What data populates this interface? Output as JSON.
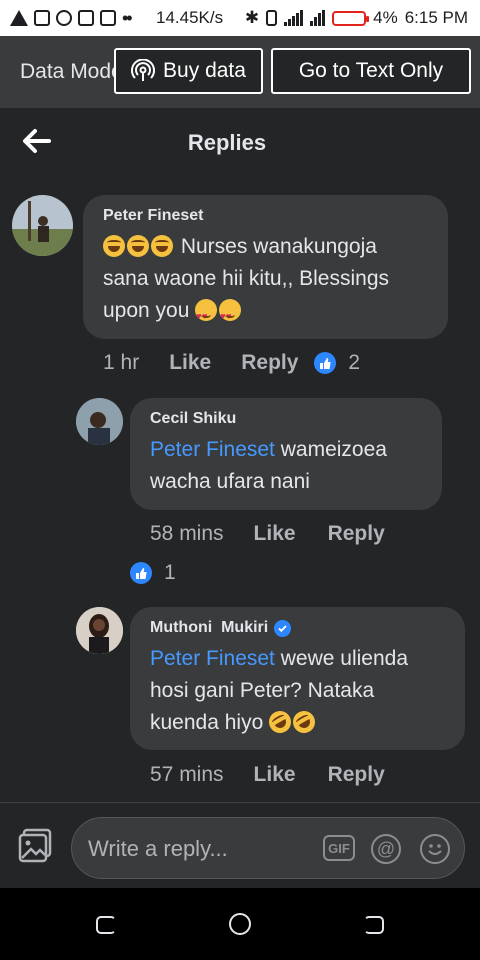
{
  "status_bar": {
    "speed": "14.45K/s",
    "battery_percent": "4%",
    "time": "6:15 PM",
    "icons": [
      "warning-icon",
      "news-icon",
      "facebook-icon",
      "instagram-icon",
      "messenger-icon",
      "bluetooth-icon",
      "vibrate-icon",
      "signal-icon",
      "battery-icon"
    ]
  },
  "data_bar": {
    "mode_label": "Data Mode",
    "buy_data_label": "Buy data",
    "text_only_label": "Go to Text Only"
  },
  "header": {
    "title": "Replies"
  },
  "comments": [
    {
      "author": "Peter Fineset",
      "text_main": " Nurses wanakungoja sana waone hii kitu,, Blessings upon you ",
      "emojis_before": [
        "face-with-tears-of-joy",
        "face-with-tears-of-joy",
        "face-with-tears-of-joy"
      ],
      "emojis_after": [
        "smiling-face-with-hearts",
        "smiling-face-with-hearts"
      ],
      "time": "1 hr",
      "like_label": "Like",
      "reply_label": "Reply",
      "reaction_count": "2"
    },
    {
      "author": "Cecil Shiku",
      "mention": "Peter Fineset",
      "text_main": " wameizoea wacha ufara nani",
      "time": "58 mins",
      "like_label": "Like",
      "reply_label": "Reply",
      "reaction_count": "1"
    },
    {
      "author": "Muthoni  Mukiri",
      "verified": true,
      "mention": "Peter Fineset",
      "text_main": " wewe ulienda hosi gani Peter? Nataka kuenda hiyo ",
      "emojis_after": [
        "rolling-on-floor-laughing",
        "rolling-on-floor-laughing"
      ],
      "time": "57 mins",
      "like_label": "Like",
      "reply_label": "Reply"
    }
  ],
  "composer": {
    "placeholder": "Write a reply...",
    "gif_label": "GIF",
    "at_label": "@"
  },
  "colors": {
    "background": "#242526",
    "bubble": "#3a3b3c",
    "mention": "#4599ff",
    "like_badge": "#2d88ff"
  }
}
